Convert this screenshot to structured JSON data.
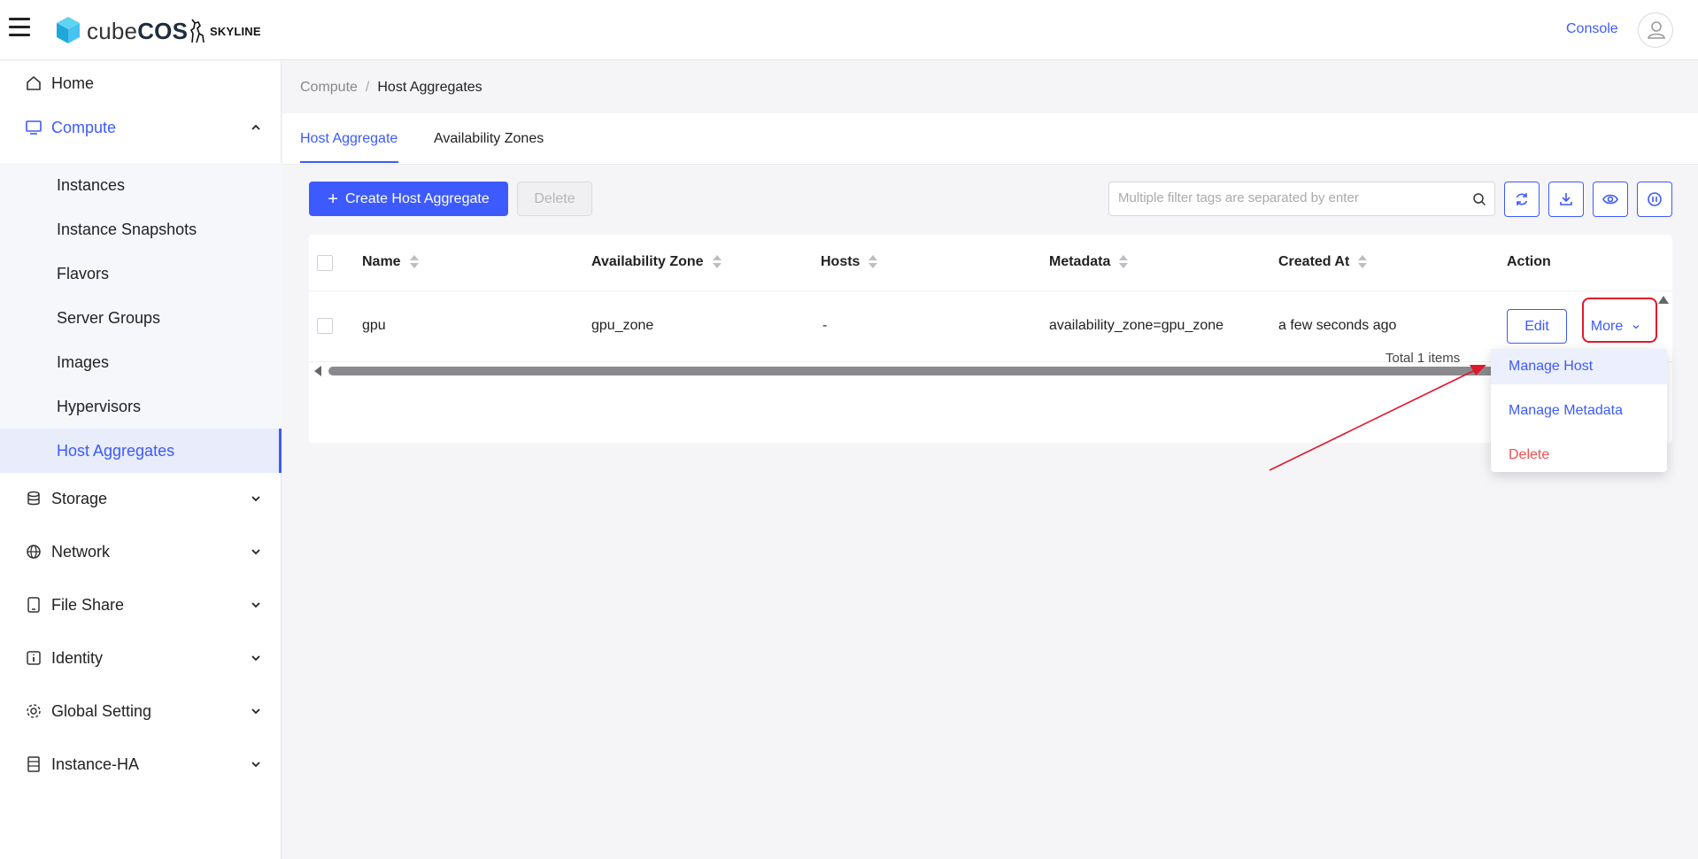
{
  "header": {
    "brand_light": "cube",
    "brand_bold": "COS",
    "skyline_logo": "SKYLINE",
    "console_link": "Console"
  },
  "sidebar": {
    "items": [
      {
        "label": "Home",
        "icon": "home-icon"
      },
      {
        "label": "Compute",
        "icon": "monitor-icon",
        "expanded": true
      },
      {
        "label": "Storage",
        "icon": "database-icon"
      },
      {
        "label": "Network",
        "icon": "globe-icon"
      },
      {
        "label": "File Share",
        "icon": "tablet-icon"
      },
      {
        "label": "Identity",
        "icon": "info-icon"
      },
      {
        "label": "Global Setting",
        "icon": "gear-icon"
      },
      {
        "label": "Instance-HA",
        "icon": "server-icon"
      }
    ],
    "compute_children": [
      "Instances",
      "Instance Snapshots",
      "Flavors",
      "Server Groups",
      "Images",
      "Hypervisors",
      "Host Aggregates"
    ],
    "selected": "Host Aggregates"
  },
  "breadcrumb": {
    "parent": "Compute",
    "separator": "/",
    "current": "Host Aggregates"
  },
  "tabs": [
    {
      "label": "Host Aggregate",
      "active": true
    },
    {
      "label": "Availability Zones",
      "active": false
    }
  ],
  "toolbar": {
    "create_label": "Create Host Aggregate",
    "delete_label": "Delete",
    "search_placeholder": "Multiple filter tags are separated by enter",
    "tool_icons": [
      "refresh-icon",
      "download-icon",
      "eye-icon",
      "pause-icon"
    ]
  },
  "table": {
    "columns": [
      "Name",
      "Availability Zone",
      "Hosts",
      "Metadata",
      "Created At",
      "Action"
    ],
    "rows": [
      {
        "name": "gpu",
        "availability_zone": "gpu_zone",
        "hosts": "-",
        "metadata": "availability_zone=gpu_zone",
        "created_at": "a few seconds ago"
      }
    ],
    "edit_label": "Edit",
    "more_label": "More"
  },
  "pager": {
    "total_text": "Total 1 items"
  },
  "more_menu": {
    "items": [
      {
        "label": "Manage Host",
        "hovered": true
      },
      {
        "label": "Manage Metadata"
      },
      {
        "label": "Delete",
        "danger": true
      }
    ]
  },
  "colors": {
    "primary": "#3d5afe",
    "danger": "#f05050",
    "annotation": "#e0182d"
  }
}
